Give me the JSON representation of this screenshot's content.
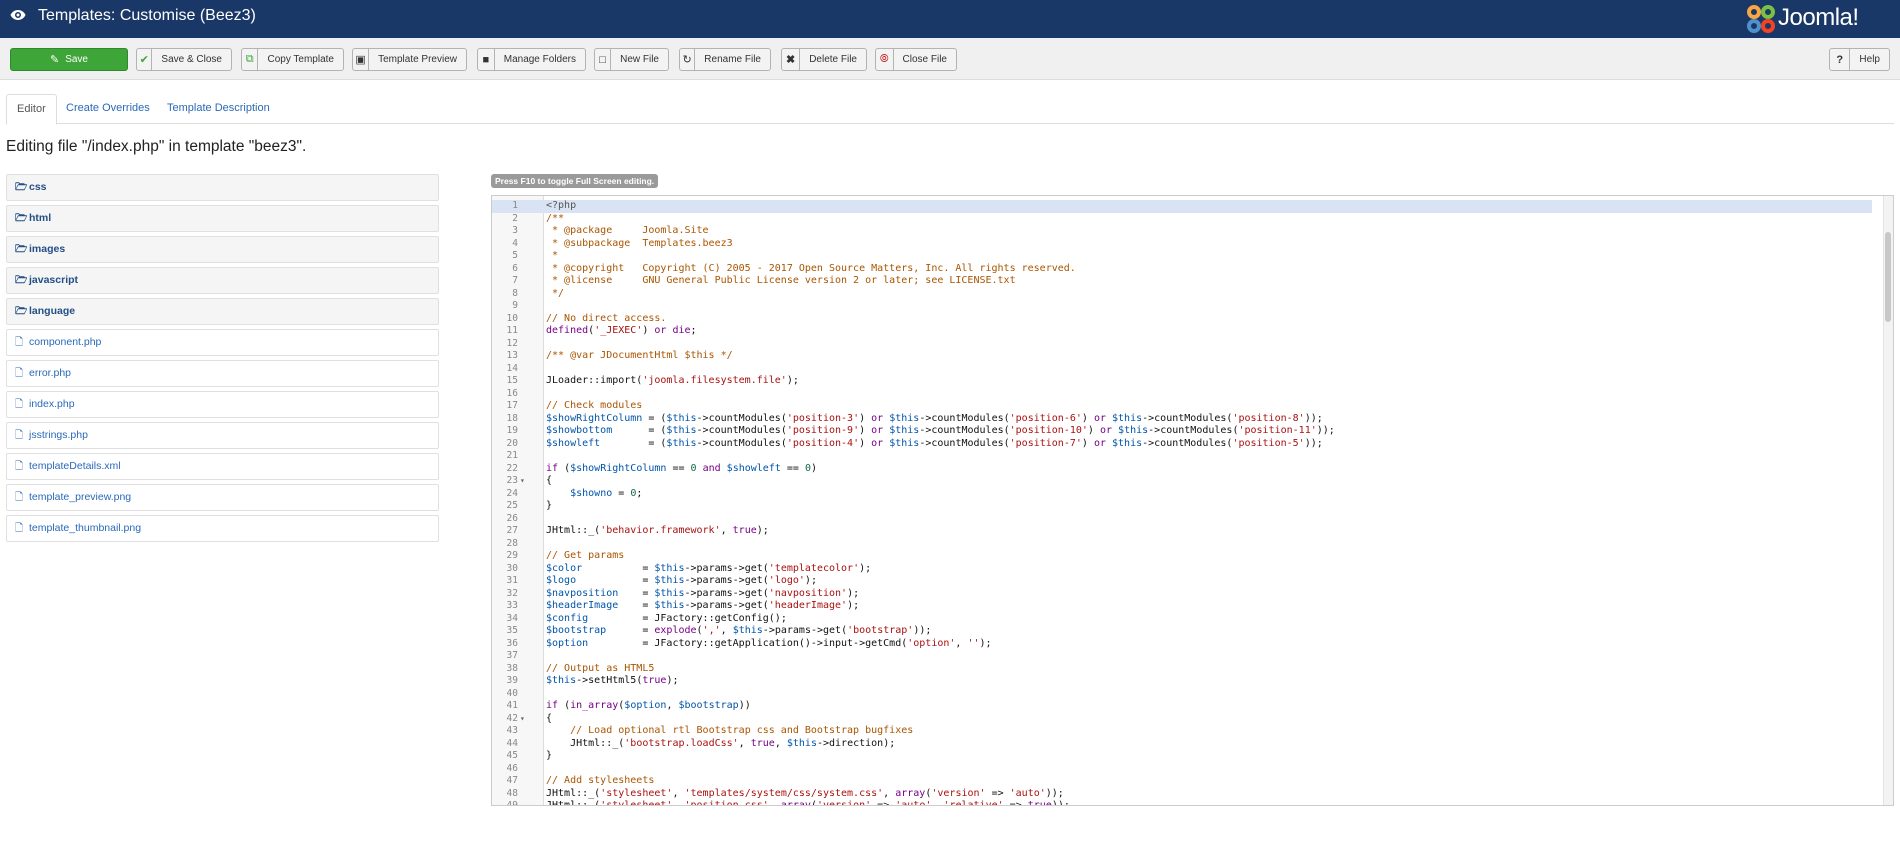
{
  "header": {
    "title": "Templates: Customise (Beez3)",
    "logo_text": "Joomla!"
  },
  "toolbar": {
    "buttons": [
      {
        "id": "save",
        "label": "Save",
        "icon": "edit-icon"
      },
      {
        "id": "save-close",
        "label": "Save & Close",
        "icon": "check-icon"
      },
      {
        "id": "copy-template",
        "label": "Copy Template",
        "icon": "copy-icon"
      },
      {
        "id": "template-preview",
        "label": "Template Preview",
        "icon": "picture-icon"
      },
      {
        "id": "manage-folders",
        "label": "Manage Folders",
        "icon": "folder-icon"
      },
      {
        "id": "new-file",
        "label": "New File",
        "icon": "file-icon"
      },
      {
        "id": "rename-file",
        "label": "Rename File",
        "icon": "refresh-icon"
      },
      {
        "id": "delete-file",
        "label": "Delete File",
        "icon": "times-icon"
      },
      {
        "id": "close-file",
        "label": "Close File",
        "icon": "close-circle-icon"
      },
      {
        "id": "help",
        "label": "Help",
        "icon": "question-icon"
      }
    ]
  },
  "tabs": [
    "Editor",
    "Create Overrides",
    "Template Description"
  ],
  "active_tab": "Editor",
  "editing_text": "Editing file \"/index.php\" in template \"beez3\".",
  "f10_hint": "Press F10 to toggle Full Screen editing.",
  "file_tree": {
    "folders": [
      "css",
      "html",
      "images",
      "javascript",
      "language"
    ],
    "files": [
      "component.php",
      "error.php",
      "index.php",
      "jsstrings.php",
      "templateDetails.xml",
      "template_preview.png",
      "template_thumbnail.png"
    ]
  },
  "colors": {
    "header_bg": "#1a3867",
    "save_green": "#3ea539",
    "link_blue": "#2a69b8",
    "folder_text": "#224f85",
    "active_line": "#d8e3f4"
  },
  "editor": {
    "active_line": 1,
    "fold_markers": [
      23,
      42
    ],
    "lines": [
      "<?php",
      "/**",
      " * @package     Joomla.Site",
      " * @subpackage  Templates.beez3",
      " *",
      " * @copyright   Copyright (C) 2005 - 2017 Open Source Matters, Inc. All rights reserved.",
      " * @license     GNU General Public License version 2 or later; see LICENSE.txt",
      " */",
      "",
      "// No direct access.",
      "defined('_JEXEC') or die;",
      "",
      "/** @var JDocumentHtml $this */",
      "",
      "JLoader::import('joomla.filesystem.file');",
      "",
      "// Check modules",
      "$showRightColumn = ($this->countModules('position-3') or $this->countModules('position-6') or $this->countModules('position-8'));",
      "$showbottom      = ($this->countModules('position-9') or $this->countModules('position-10') or $this->countModules('position-11'));",
      "$showleft        = ($this->countModules('position-4') or $this->countModules('position-7') or $this->countModules('position-5'));",
      "",
      "if ($showRightColumn == 0 and $showleft == 0)",
      "{",
      "    $showno = 0;",
      "}",
      "",
      "JHtml::_('behavior.framework', true);",
      "",
      "// Get params",
      "$color          = $this->params->get('templatecolor');",
      "$logo           = $this->params->get('logo');",
      "$navposition    = $this->params->get('navposition');",
      "$headerImage    = $this->params->get('headerImage');",
      "$config         = JFactory::getConfig();",
      "$bootstrap      = explode(',', $this->params->get('bootstrap'));",
      "$option         = JFactory::getApplication()->input->getCmd('option', '');",
      "",
      "// Output as HTML5",
      "$this->setHtml5(true);",
      "",
      "if (in_array($option, $bootstrap))",
      "{",
      "    // Load optional rtl Bootstrap css and Bootstrap bugfixes",
      "    JHtml::_('bootstrap.loadCss', true, $this->direction);",
      "}",
      "",
      "// Add stylesheets",
      "JHtml::_('stylesheet', 'templates/system/css/system.css', array('version' => 'auto'));",
      "JHtml::_('stylesheet', 'position.css', array('version' => 'auto', 'relative' => true));"
    ]
  }
}
